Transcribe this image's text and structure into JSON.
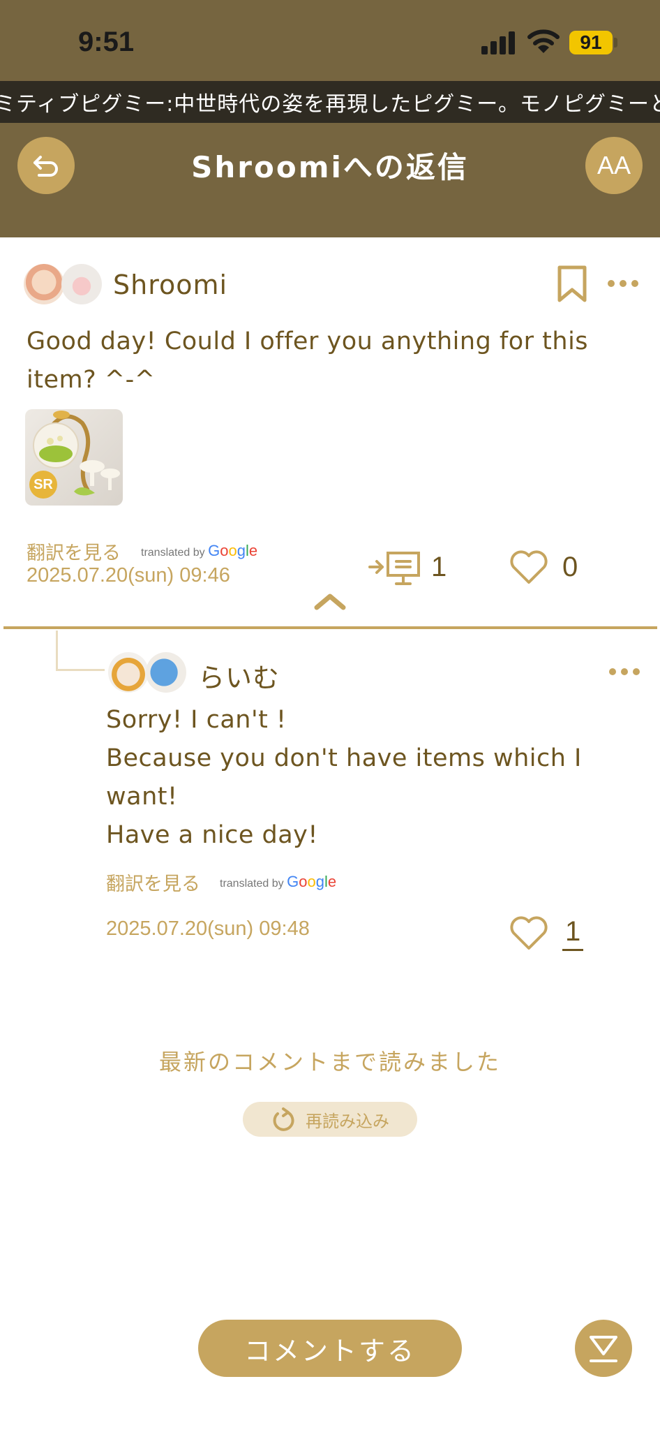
{
  "status_bar": {
    "time": "9:51",
    "battery": "91"
  },
  "ticker": {
    "text": "ミティブピグミー:中世時代の姿を再現したピグミー。モノピグミーと"
  },
  "header": {
    "title": "Shroomiへの返信",
    "font_button_label": "AA"
  },
  "post": {
    "author": "Shroomi",
    "body": "Good day! Could I offer you anything for this item? ^-^",
    "item_badge": "SR",
    "translate_label": "翻訳を見る",
    "translated_by": "translated by",
    "date": "2025.07.20(sun) 09:46",
    "reply_count": "1",
    "like_count": "0"
  },
  "reply": {
    "author": "らいむ",
    "lines": [
      "Sorry! I can't !",
      "Because you don't have items which I",
      "want!",
      "Have a nice day!"
    ],
    "translate_label": "翻訳を見る",
    "translated_by": "translated by",
    "date": "2025.07.20(sun) 09:48",
    "like_count": "1"
  },
  "footer": {
    "read_all": "最新のコメントまで読みました",
    "reload": "再読み込み",
    "comment_button": "コメントする"
  },
  "colors": {
    "header_bg": "#766540",
    "accent": "#c6a55f",
    "text_brown": "#6d5520"
  }
}
